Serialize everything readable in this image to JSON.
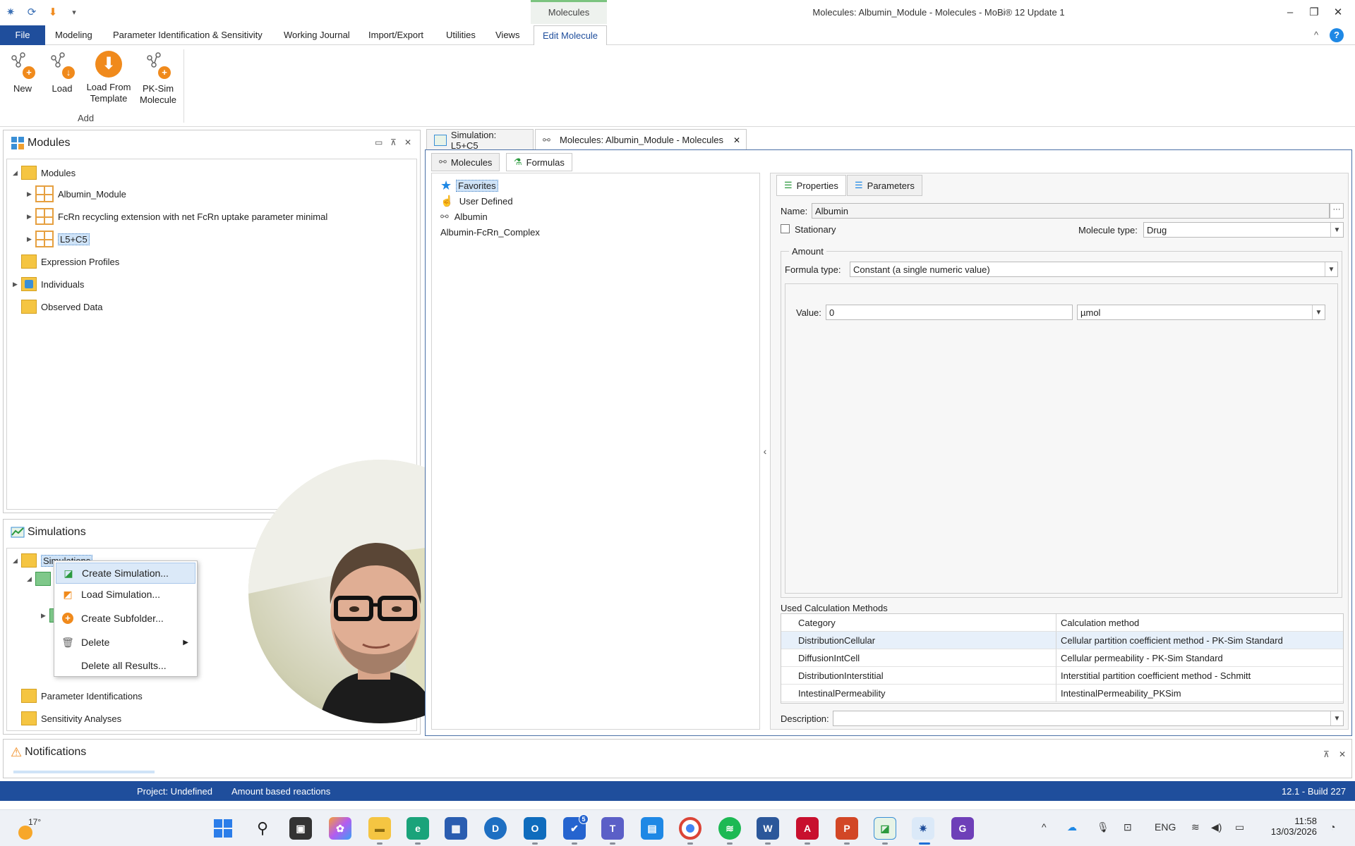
{
  "titlebar": {
    "context_tab": "Molecules",
    "window_title": "Molecules: Albumin_Module - Molecules - MoBi® 12 Update 1",
    "minimize": "–",
    "restore": "❐",
    "close": "✕",
    "qat_dropdown": "▾"
  },
  "menu": {
    "file": "File",
    "items": [
      "Modeling",
      "Parameter Identification & Sensitivity",
      "Working Journal",
      "Import/Export",
      "Utilities",
      "Views"
    ],
    "active": "Edit Molecule",
    "collapse": "^",
    "help": "?"
  },
  "ribbon": {
    "buttons": [
      "New",
      "Load",
      "Load From Template",
      "PK-Sim Molecule"
    ],
    "group_label": "Add"
  },
  "modules_panel": {
    "title": "Modules",
    "tree": [
      "Modules",
      "Albumin_Module",
      "FcRn recycling extension with net FcRn uptake parameter minimal",
      "L5+C5",
      "Expression Profiles",
      "Individuals",
      "Observed Data"
    ]
  },
  "simulations_panel": {
    "title": "Simulations",
    "root": "Simulations",
    "bottom_items": [
      "Parameter Identifications",
      "Sensitivity Analyses"
    ]
  },
  "context_menu": {
    "items": [
      "Create Simulation...",
      "Load Simulation...",
      "Create Subfolder...",
      "Delete",
      "Delete all Results..."
    ]
  },
  "doc_tabs": {
    "tab1": "Simulation: L5+C5",
    "tab2": "Molecules: Albumin_Module - Molecules",
    "close": "✕"
  },
  "molecules_view": {
    "subtabs": [
      "Molecules",
      "Formulas"
    ],
    "list": [
      "Favorites",
      "User Defined",
      "Albumin",
      "Albumin-FcRn_Complex"
    ]
  },
  "properties": {
    "tabs": [
      "Properties",
      "Parameters"
    ],
    "name_label": "Name:",
    "name_value": "Albumin",
    "ellipsis": "···",
    "stationary_label": "Stationary",
    "molecule_type_label": "Molecule type:",
    "molecule_type_value": "Drug",
    "amount_label": "Amount",
    "formula_type_label": "Formula type:",
    "formula_type_value": "Constant (a single numeric value)",
    "value_label": "Value:",
    "value": "0",
    "unit": "µmol",
    "calc_methods_label": "Used Calculation Methods",
    "calc_headers": [
      "Category",
      "Calculation method"
    ],
    "calc_rows": [
      [
        "DistributionCellular",
        "Cellular partition coefficient method - PK-Sim Standard"
      ],
      [
        "DiffusionIntCell",
        "Cellular permeability - PK-Sim Standard"
      ],
      [
        "DistributionInterstitial",
        "Interstitial partition coefficient method - Schmitt"
      ],
      [
        "IntestinalPermeability",
        "IntestinalPermeability_PKSim"
      ]
    ],
    "description_label": "Description:",
    "splitter": "‹"
  },
  "notifications": {
    "title": "Notifications"
  },
  "statusbar": {
    "project": "Project: Undefined",
    "mode": "Amount based reactions",
    "build": "12.1 - Build 227"
  },
  "taskbar": {
    "weather": "17°",
    "lang": "ENG",
    "time": "11:58",
    "date": "13/03/2026",
    "todo_badge": "5",
    "up_chevron": "^"
  },
  "colors": {
    "accent": "#1f4e9c",
    "orange": "#f08a1c",
    "selection": "#cfe3f7"
  }
}
